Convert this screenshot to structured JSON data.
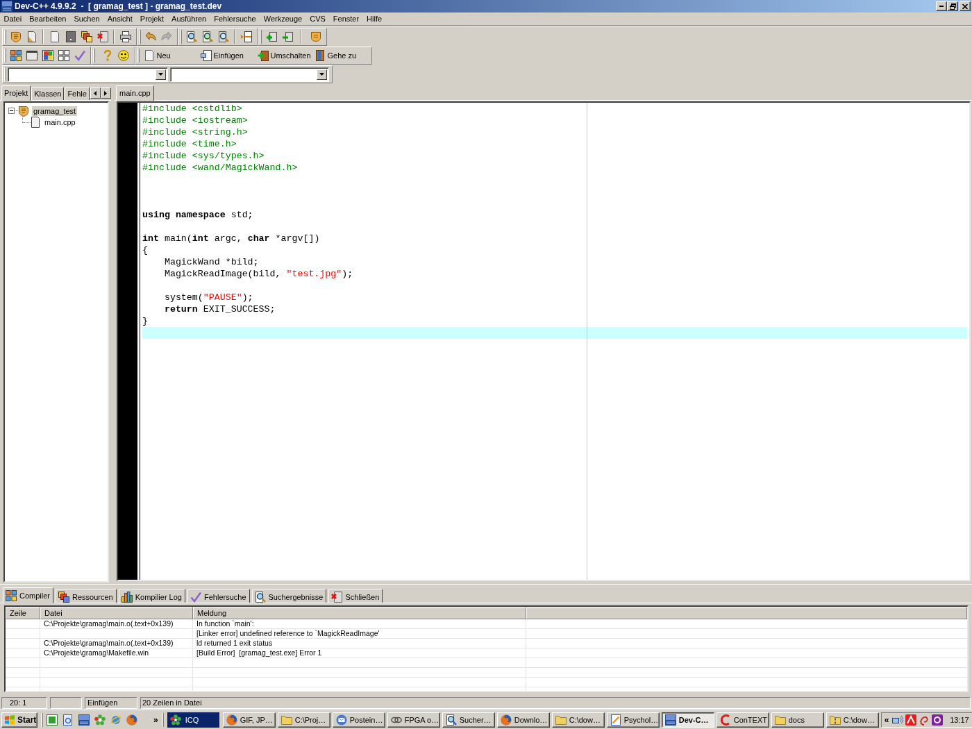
{
  "window": {
    "title": "Dev-C++ 4.9.9.2  -  [ gramag_test ] - gramag_test.dev"
  },
  "menu": [
    "Datei",
    "Bearbeiten",
    "Suchen",
    "Ansicht",
    "Projekt",
    "Ausführen",
    "Fehlersuche",
    "Werkzeuge",
    "CVS",
    "Fenster",
    "Hilfe"
  ],
  "toolbar": {
    "history": [
      {
        "kind": "undo",
        "disabled": false
      },
      {
        "kind": "redo",
        "disabled": true
      }
    ],
    "buttons": [
      {
        "kind": "new",
        "label": "Neu"
      },
      {
        "kind": "insert",
        "label": "Einfügen"
      },
      {
        "kind": "toggle",
        "label": "Umschalten"
      },
      {
        "kind": "goto",
        "label": "Gehe zu"
      }
    ]
  },
  "left_panel": {
    "tabs": [
      {
        "label": "Projekt",
        "selected": true
      },
      {
        "label": "Klassen",
        "selected": false
      },
      {
        "label": "Fehle",
        "selected": false
      }
    ],
    "tree": [
      {
        "kind": "project",
        "label": "gramag_test",
        "selected": true,
        "expanded": true,
        "children": [
          {
            "kind": "file",
            "label": "main.cpp",
            "selected": false
          }
        ]
      }
    ]
  },
  "editor": {
    "tabs": [
      {
        "label": "main.cpp",
        "selected": true
      }
    ],
    "lines": [
      {
        "current": false,
        "tokens": [
          {
            "kind": "preprocessor",
            "text": "#include <cstdlib>"
          }
        ]
      },
      {
        "current": false,
        "tokens": [
          {
            "kind": "preprocessor",
            "text": "#include <iostream>"
          }
        ]
      },
      {
        "current": false,
        "tokens": [
          {
            "kind": "preprocessor",
            "text": "#include <string.h>"
          }
        ]
      },
      {
        "current": false,
        "tokens": [
          {
            "kind": "preprocessor",
            "text": "#include <time.h>"
          }
        ]
      },
      {
        "current": false,
        "tokens": [
          {
            "kind": "preprocessor",
            "text": "#include <sys/types.h>"
          }
        ]
      },
      {
        "current": false,
        "tokens": [
          {
            "kind": "preprocessor",
            "text": "#include <wand/MagickWand.h>"
          }
        ]
      },
      {
        "current": false
      },
      {
        "current": false
      },
      {
        "current": false
      },
      {
        "current": false,
        "tokens": [
          {
            "kind": "keyword",
            "text": "using namespace"
          },
          {
            "kind": "plain",
            "text": " std;"
          }
        ]
      },
      {
        "current": false
      },
      {
        "current": false,
        "tokens": [
          {
            "kind": "keyword",
            "text": "int"
          },
          {
            "kind": "plain",
            "text": " main("
          },
          {
            "kind": "keyword",
            "text": "int"
          },
          {
            "kind": "plain",
            "text": " argc, "
          },
          {
            "kind": "keyword",
            "text": "char"
          },
          {
            "kind": "plain",
            "text": " *argv[])"
          }
        ]
      },
      {
        "current": false,
        "tokens": [
          {
            "kind": "plain",
            "text": "{"
          }
        ]
      },
      {
        "current": false,
        "tokens": [
          {
            "kind": "plain",
            "text": "    MagickWand *bild;"
          }
        ]
      },
      {
        "current": false,
        "tokens": [
          {
            "kind": "plain",
            "text": "    MagickReadImage(bild, "
          },
          {
            "kind": "string",
            "text": "\"test.jpg\""
          },
          {
            "kind": "plain",
            "text": ");"
          }
        ]
      },
      {
        "current": false
      },
      {
        "current": false,
        "tokens": [
          {
            "kind": "plain",
            "text": "    system("
          },
          {
            "kind": "string",
            "text": "\"PAUSE\""
          },
          {
            "kind": "plain",
            "text": ");"
          }
        ]
      },
      {
        "current": false,
        "tokens": [
          {
            "kind": "keyword",
            "text": "    return"
          },
          {
            "kind": "plain",
            "text": " EXIT_SUCCESS;"
          }
        ]
      },
      {
        "current": false,
        "tokens": [
          {
            "kind": "plain",
            "text": "}"
          }
        ]
      },
      {
        "current": true
      }
    ]
  },
  "messages_panel": {
    "tabs": [
      {
        "kind": "compiler",
        "label": "Compiler",
        "selected": true
      },
      {
        "kind": "resources",
        "label": "Ressourcen",
        "selected": false
      },
      {
        "kind": "log",
        "label": "Kompilier Log",
        "selected": false
      },
      {
        "kind": "debug",
        "label": "Fehlersuche",
        "selected": false
      },
      {
        "kind": "search",
        "label": "Suchergebnisse",
        "selected": false
      },
      {
        "kind": "close",
        "label": "Schließen",
        "selected": false
      }
    ],
    "table": {
      "columns": [
        "Zeile",
        "Datei",
        "Meldung"
      ],
      "rows": [
        {
          "file": "C:\\Projekte\\gramag\\main.o(.text+0x139)",
          "message": "In function `main':"
        },
        {
          "message": "[Linker error] undefined reference to `MagickReadImage'"
        },
        {
          "file": "C:\\Projekte\\gramag\\main.o(.text+0x139)",
          "message": "ld returned 1 exit status"
        },
        {
          "file": "C:\\Projekte\\gramag\\Makefile.win",
          "message": "[Build Error]  [gramag_test.exe] Error 1"
        }
      ]
    }
  },
  "status_bar": {
    "position": "20: 1",
    "mode": "Einfügen",
    "info": "20 Zeilen in Datei"
  },
  "taskbar": {
    "start": "Start",
    "more": "»",
    "deskband": "ICQ",
    "tasks": [
      {
        "kind": "browser",
        "label": "GIF, JP…",
        "active": false
      },
      {
        "kind": "folder",
        "label": "C:\\Proj…",
        "active": false
      },
      {
        "kind": "mail",
        "label": "Postein…",
        "active": false
      },
      {
        "kind": "network",
        "label": "FPGA o…",
        "active": false
      },
      {
        "kind": "search",
        "label": "Sucher…",
        "active": false
      },
      {
        "kind": "browser",
        "label": "Downlo…",
        "active": false
      },
      {
        "kind": "folder",
        "label": "C:\\dow…",
        "active": false
      },
      {
        "kind": "chart",
        "label": "Psychol…",
        "active": false
      },
      {
        "kind": "ide",
        "label": "Dev-C…",
        "active": true
      },
      {
        "kind": "editor",
        "label": "ConTEXT",
        "active": false
      },
      {
        "kind": "folder",
        "label": "docs",
        "active": false
      },
      {
        "kind": "archive",
        "label": "C:\\dow…",
        "active": false
      }
    ],
    "tray_more": "«",
    "clock": "13:17"
  }
}
